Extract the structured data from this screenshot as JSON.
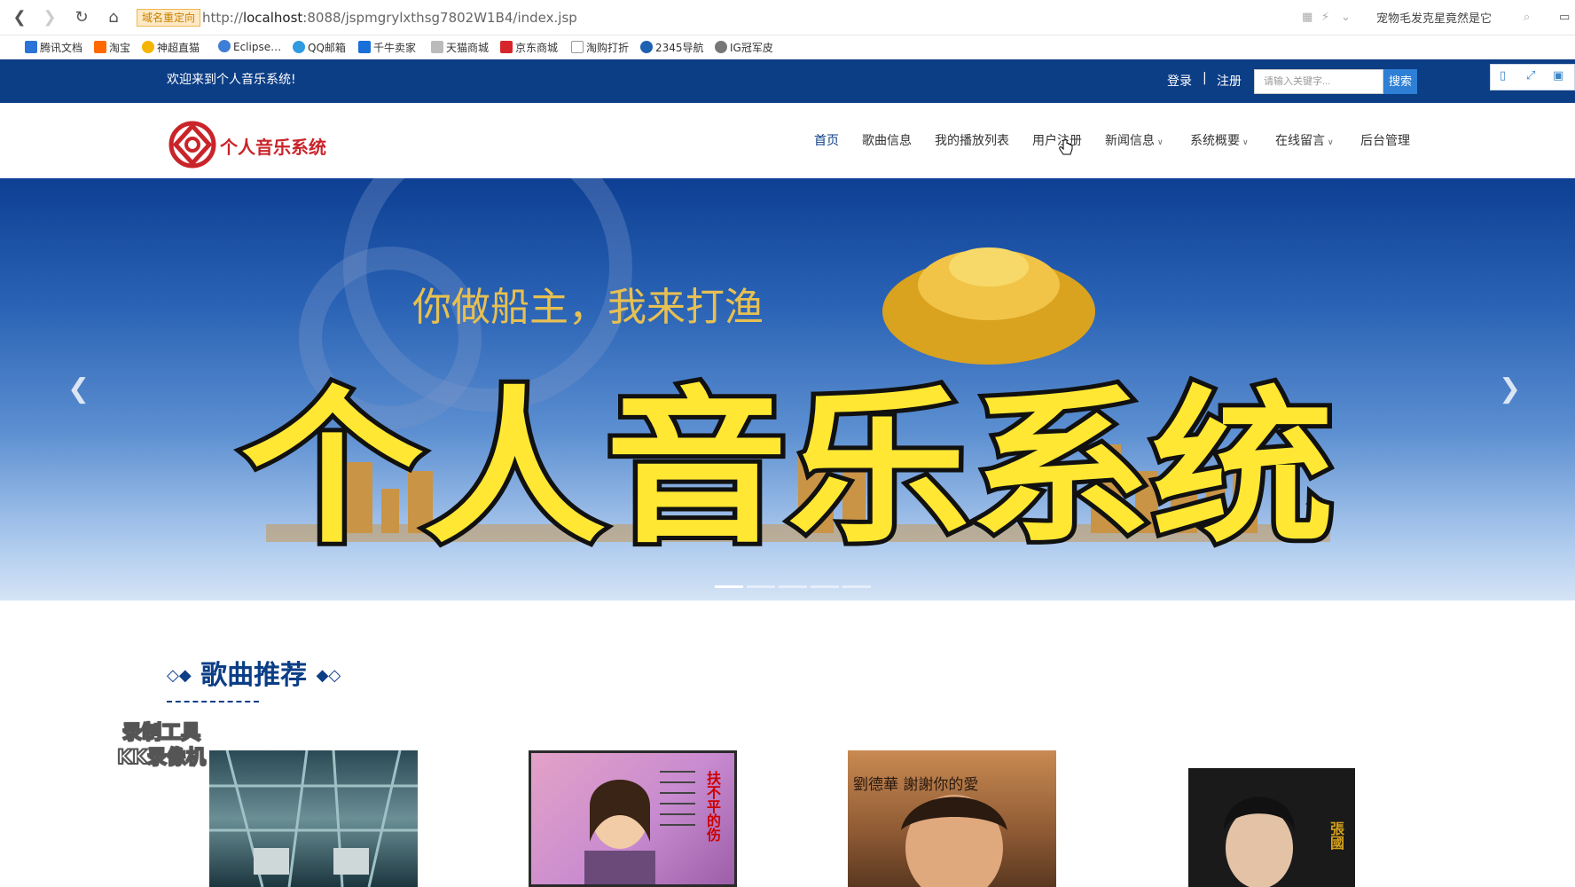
{
  "browser": {
    "redirect_tag": "域名重定向",
    "url_prefix": "http://",
    "url_host": "localhost",
    "url_rest": ":8088/jspmgrylxthsg7802W1B4/index.jsp",
    "search_hint": "宠物毛发克星竟然是它",
    "bookmarks": [
      "腾讯文档",
      "淘宝",
      "神超直猫",
      "Eclipse…",
      "QQ邮箱",
      "千牛卖家",
      "天猫商城",
      "京东商城",
      "淘购打折",
      "2345导航",
      "IG冠军皮"
    ]
  },
  "topbar": {
    "welcome": "欢迎来到个人音乐系统!",
    "login": "登录",
    "separator": "|",
    "register": "注册",
    "search_placeholder": "请输入关键字...",
    "search_button": "搜索"
  },
  "header": {
    "logo_text": "个人音乐系统",
    "nav": [
      {
        "label": "首页",
        "dropdown": false
      },
      {
        "label": "歌曲信息",
        "dropdown": false
      },
      {
        "label": "我的播放列表",
        "dropdown": false
      },
      {
        "label": "用户注册",
        "dropdown": false
      },
      {
        "label": "新闻信息",
        "dropdown": true
      },
      {
        "label": "系统概要",
        "dropdown": true
      },
      {
        "label": "在线留言",
        "dropdown": true
      },
      {
        "label": "后台管理",
        "dropdown": false
      }
    ]
  },
  "banner": {
    "slogan": "你做船主，我来打渔",
    "headline": "个人音乐系统",
    "slide_count": 5,
    "active_slide": 1
  },
  "section": {
    "title": "歌曲推荐",
    "watermark_line1": "录制工具",
    "watermark_line2": "KK录像机",
    "cover_text_1": "扶不平的伤",
    "cover_text_2": "劉德華 謝謝你的愛",
    "cover_text_3": "張國"
  },
  "colors": {
    "brand_blue": "#0c3e86",
    "brand_red": "#c9242a",
    "search_button": "#2e7fd6",
    "headline_yellow": "#ffe733"
  }
}
